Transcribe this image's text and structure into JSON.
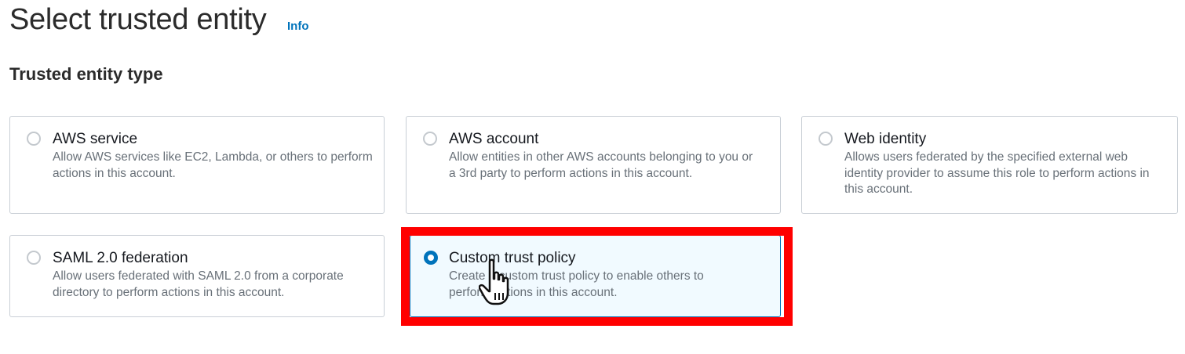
{
  "header": {
    "title": "Select trusted entity",
    "info_link": "Info"
  },
  "section": {
    "title": "Trusted entity type"
  },
  "options": [
    {
      "label": "AWS service",
      "description": "Allow AWS services like EC2, Lambda, or others to perform actions in this account.",
      "selected": false
    },
    {
      "label": "AWS account",
      "description": "Allow entities in other AWS accounts belonging to you or a 3rd party to perform actions in this account.",
      "selected": false
    },
    {
      "label": "Web identity",
      "description": "Allows users federated by the specified external web identity provider to assume this role to perform actions in this account.",
      "selected": false
    },
    {
      "label": "SAML 2.0 federation",
      "description": "Allow users federated with SAML 2.0 from a corporate directory to perform actions in this account.",
      "selected": false
    },
    {
      "label": "Custom trust policy",
      "description": "Create a custom trust policy to enable others to perform actions in this account.",
      "selected": true
    }
  ],
  "colors": {
    "accent": "#0073bb",
    "highlight": "#ff0000",
    "selected_bg": "#f1faff"
  },
  "icons": {
    "cursor": "hand-pointer-icon"
  }
}
